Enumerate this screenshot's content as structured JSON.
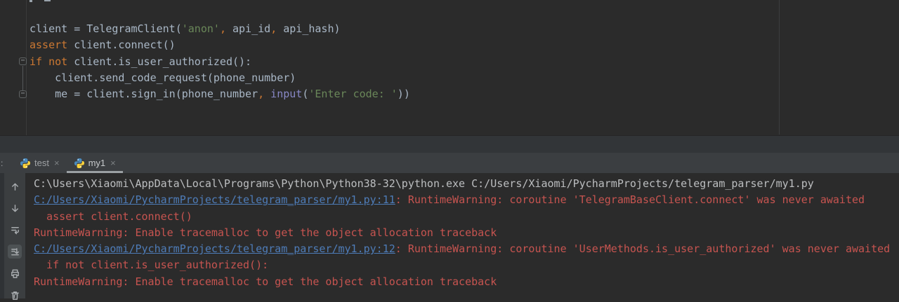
{
  "colors": {
    "editor_bg": "#2b2b2b",
    "console_bg": "#2b2b2b",
    "code_plain": "#a9b7c6",
    "code_keyword": "#cc7832",
    "code_string": "#6a8759",
    "code_builtin": "#8888c6",
    "console_plain": "#bcbec0",
    "console_error": "#c75450",
    "console_link": "#4e7cb8",
    "tabbar_bg": "#3b3e41",
    "active_tab_underline": "#9ba0a3",
    "python_icon_blue": "#4b8bbe",
    "python_icon_yellow": "#ffd43b"
  },
  "editor": {
    "lines": [
      {
        "tokens": [
          {
            "text": "client = TelegramClient(",
            "type": "plain"
          },
          {
            "text": "'anon'",
            "type": "string"
          },
          {
            "text": ",",
            "type": "keyword"
          },
          {
            "text": " api_id",
            "type": "plain"
          },
          {
            "text": ",",
            "type": "keyword"
          },
          {
            "text": " api_hash)",
            "type": "plain"
          }
        ]
      },
      {
        "tokens": [
          {
            "text": "assert",
            "type": "keyword"
          },
          {
            "text": " client.connect()",
            "type": "plain"
          }
        ]
      },
      {
        "tokens": [
          {
            "text": "if not",
            "type": "keyword"
          },
          {
            "text": " client.is_user_authorized():",
            "type": "plain"
          }
        ]
      },
      {
        "tokens": [
          {
            "text": "    client.send_code_request(phone_number)",
            "type": "plain"
          }
        ]
      },
      {
        "tokens": [
          {
            "text": "    me = client.sign_in(phone_number",
            "type": "plain"
          },
          {
            "text": ",",
            "type": "keyword"
          },
          {
            "text": " ",
            "type": "plain"
          },
          {
            "text": "input",
            "type": "builtin"
          },
          {
            "text": "(",
            "type": "plain"
          },
          {
            "text": "'Enter code: '",
            "type": "string"
          },
          {
            "text": "))",
            "type": "plain"
          }
        ]
      }
    ]
  },
  "run_panel": {
    "left_label": ":",
    "close_glyph": "×",
    "tabs": [
      {
        "label": "test",
        "active": false,
        "icon": "python-icon"
      },
      {
        "label": "my1",
        "active": true,
        "icon": "python-icon"
      }
    ],
    "toolbar_icons": [
      "up-stack",
      "down-stack",
      "soft-wrap",
      "scroll-to-end",
      "print",
      "clear-all"
    ],
    "console": {
      "lines": [
        {
          "segments": [
            {
              "text": "C:\\Users\\Xiaomi\\AppData\\Local\\Programs\\Python\\Python38-32\\python.exe C:/Users/Xiaomi/PycharmProjects/telegram_parser/my1.py",
              "type": "plain"
            }
          ]
        },
        {
          "segments": [
            {
              "text": "C:/Users/Xiaomi/PycharmProjects/telegram_parser/my1.py:11",
              "type": "link"
            },
            {
              "text": ": RuntimeWarning: coroutine 'TelegramBaseClient.connect' was never awaited",
              "type": "error"
            }
          ]
        },
        {
          "segments": [
            {
              "text": "  assert client.connect()",
              "type": "error"
            }
          ]
        },
        {
          "segments": [
            {
              "text": "RuntimeWarning: Enable tracemalloc to get the object allocation traceback",
              "type": "error"
            }
          ]
        },
        {
          "segments": [
            {
              "text": "C:/Users/Xiaomi/PycharmProjects/telegram_parser/my1.py:12",
              "type": "link"
            },
            {
              "text": ": RuntimeWarning: coroutine 'UserMethods.is_user_authorized' was never awaited",
              "type": "error"
            }
          ]
        },
        {
          "segments": [
            {
              "text": "  if not client.is_user_authorized():",
              "type": "error"
            }
          ]
        },
        {
          "segments": [
            {
              "text": "RuntimeWarning: Enable tracemalloc to get the object allocation traceback",
              "type": "error"
            }
          ]
        }
      ]
    }
  }
}
